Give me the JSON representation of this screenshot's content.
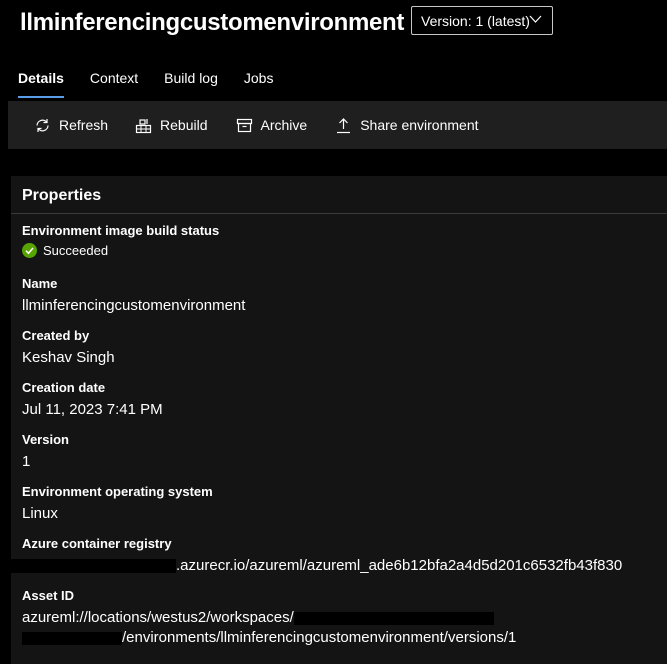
{
  "header": {
    "title": "llminferencingcustomenvironment",
    "version_label": "Version: 1 (latest)"
  },
  "tabs": [
    {
      "label": "Details",
      "active": true
    },
    {
      "label": "Context",
      "active": false
    },
    {
      "label": "Build log",
      "active": false
    },
    {
      "label": "Jobs",
      "active": false
    }
  ],
  "toolbar": {
    "refresh": "Refresh",
    "rebuild": "Rebuild",
    "archive": "Archive",
    "share": "Share environment"
  },
  "properties": {
    "title": "Properties",
    "build_status_label": "Environment image build status",
    "build_status_value": "Succeeded",
    "name_label": "Name",
    "name_value": "llminferencingcustomenvironment",
    "created_by_label": "Created by",
    "created_by_value": "Keshav Singh",
    "creation_date_label": "Creation date",
    "creation_date_value": "Jul 11, 2023 7:41 PM",
    "version_label": "Version",
    "version_value": "1",
    "os_label": "Environment operating system",
    "os_value": "Linux",
    "acr_label": "Azure container registry",
    "acr_value": ".azurecr.io/azureml/azureml_ade6b12bfa2a4d5d201c6532fb43f830",
    "asset_id_label": "Asset ID",
    "asset_id_line1": "azureml://locations/westus2/workspaces/",
    "asset_id_line2": "/environments/llminferencingcustomenvironment/versions/1"
  },
  "colors": {
    "background": "#000000",
    "panel": "#141414",
    "toolbar": "#1f1f1f",
    "accent": "#5a9de6",
    "success": "#57a300"
  }
}
